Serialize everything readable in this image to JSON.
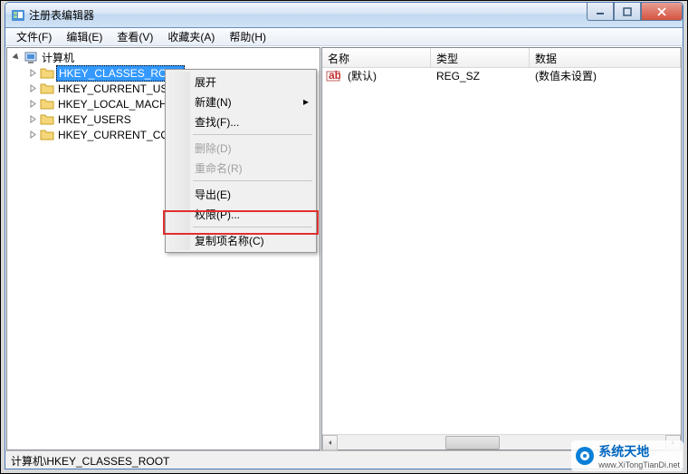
{
  "titlebar": {
    "title": "注册表编辑器"
  },
  "menubar": {
    "items": [
      "文件(F)",
      "编辑(E)",
      "查看(V)",
      "收藏夹(A)",
      "帮助(H)"
    ]
  },
  "tree": {
    "root": "计算机",
    "items": [
      "HKEY_CLASSES_ROOT",
      "HKEY_CURRENT_USER",
      "HKEY_LOCAL_MACHINE",
      "HKEY_USERS",
      "HKEY_CURRENT_CONFIG"
    ],
    "selected_index": 0
  },
  "list": {
    "headers": {
      "name": "名称",
      "type": "类型",
      "data": "数据"
    },
    "rows": [
      {
        "name": "(默认)",
        "type": "REG_SZ",
        "data": "(数值未设置)"
      }
    ]
  },
  "context_menu": {
    "items": [
      {
        "label": "展开",
        "enabled": true
      },
      {
        "label": "新建(N)",
        "enabled": true,
        "submenu": true
      },
      {
        "label": "查找(F)...",
        "enabled": true
      },
      {
        "sep": true
      },
      {
        "label": "删除(D)",
        "enabled": false
      },
      {
        "label": "重命名(R)",
        "enabled": false
      },
      {
        "sep": true
      },
      {
        "label": "导出(E)",
        "enabled": true
      },
      {
        "label": "权限(P)...",
        "enabled": true
      },
      {
        "sep": true
      },
      {
        "label": "复制项名称(C)",
        "enabled": true
      }
    ]
  },
  "statusbar": {
    "path": "计算机\\HKEY_CLASSES_ROOT"
  },
  "watermark": {
    "line1": "系统天地",
    "line2": "www.XiTongTianDi.net"
  }
}
